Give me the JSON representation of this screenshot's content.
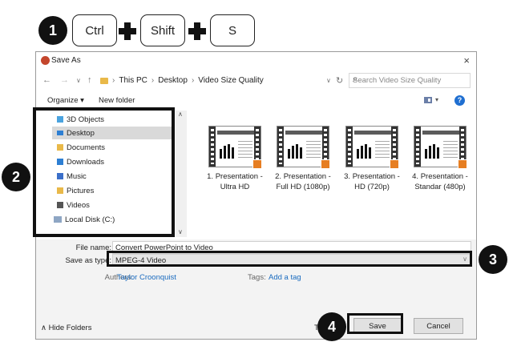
{
  "shortcut": {
    "step_number": "1",
    "keys": [
      "Ctrl",
      "Shift",
      "S"
    ]
  },
  "callouts": [
    "2",
    "3",
    "4"
  ],
  "dialog": {
    "title": "Save As",
    "close_glyph": "×",
    "breadcrumb": [
      "This PC",
      "Desktop",
      "Video Size Quality"
    ],
    "search_placeholder": "Search Video Size Quality",
    "organize_label": "Organize ▾",
    "new_folder_label": "New folder",
    "help_glyph": "?",
    "nav_items": [
      {
        "label": "3D Objects",
        "icon": "3d-objects-icon"
      },
      {
        "label": "Desktop",
        "icon": "desktop-icon",
        "selected": true
      },
      {
        "label": "Documents",
        "icon": "documents-icon"
      },
      {
        "label": "Downloads",
        "icon": "downloads-icon"
      },
      {
        "label": "Music",
        "icon": "music-icon"
      },
      {
        "label": "Pictures",
        "icon": "pictures-icon"
      },
      {
        "label": "Videos",
        "icon": "videos-icon"
      },
      {
        "label": "Local Disk (C:)",
        "icon": "local-disk-icon"
      }
    ],
    "files": [
      {
        "line1": "1. Presentation -",
        "line2": "Ultra HD"
      },
      {
        "line1": "2. Presentation -",
        "line2": "Full HD (1080p)"
      },
      {
        "line1": "3. Presentation -",
        "line2": "HD (720p)"
      },
      {
        "line1": "4. Presentation -",
        "line2": "Standar (480p)"
      }
    ],
    "file_name_label": "File name:",
    "file_name_value": "Convert PowerPoint to Video",
    "save_type_label": "Save as type:",
    "save_type_value": "MPEG-4 Video",
    "authors_label": "Authors:",
    "authors_value": "Taylor Croonquist",
    "tags_label": "Tags:",
    "tags_value": "Add a tag",
    "hide_folders_label": "Hide Folders",
    "tools_partial": "T",
    "save_label": "Save",
    "cancel_label": "Cancel"
  },
  "colors": {
    "accent_blue": "#1a6bbf",
    "highlight": "#111111",
    "selection": "#d9d9d9"
  }
}
